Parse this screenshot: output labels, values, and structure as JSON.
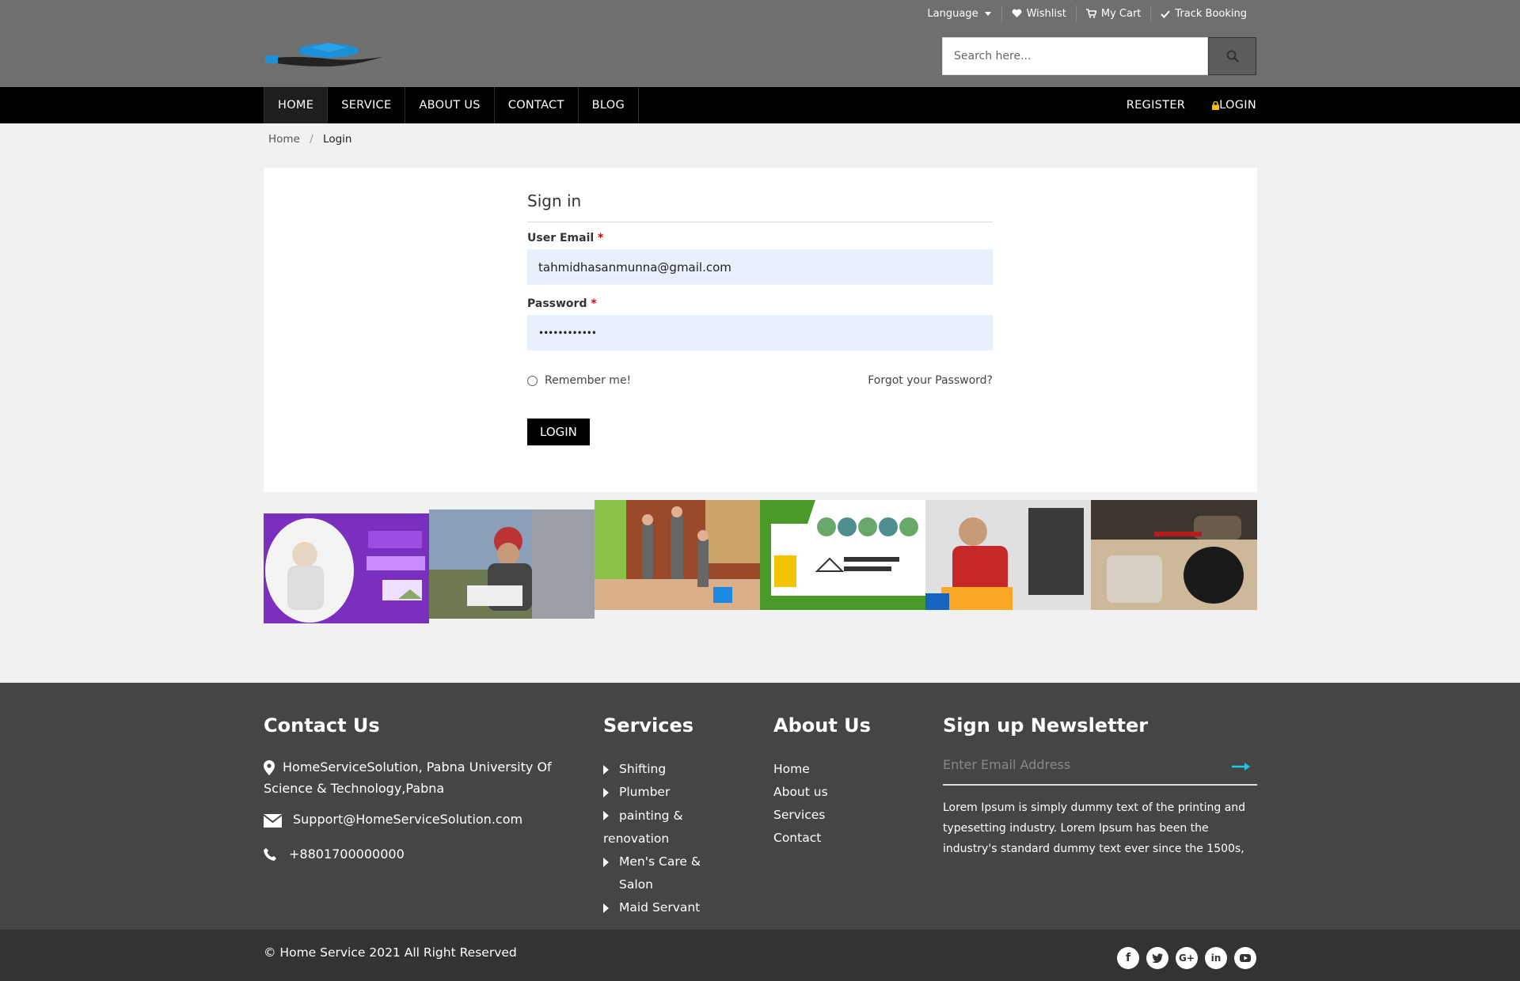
{
  "topbar": {
    "language_label": "Language",
    "wishlist_label": "Wishlist",
    "cart_label": "My Cart",
    "track_label": "Track Booking",
    "search_placeholder": "Search here..."
  },
  "nav": {
    "items": [
      {
        "label": "HOME"
      },
      {
        "label": "SERVICE"
      },
      {
        "label": "ABOUT US"
      },
      {
        "label": "CONTACT"
      },
      {
        "label": "BLOG"
      }
    ],
    "register_label": "REGISTER",
    "login_label": "LOGIN"
  },
  "breadcrumb": {
    "home": "Home",
    "separator": "/",
    "current": "Login"
  },
  "login_form": {
    "title": "Sign in",
    "email_label": "User Email",
    "required_mark": "*",
    "email_value": "tahmidhasanmunna@gmail.com",
    "password_label": "Password",
    "password_value": "••••••••••••",
    "remember_label": "Remember me!",
    "forgot_label": "Forgot your Password?",
    "submit_label": "LOGIN"
  },
  "gallery": {
    "images": [
      {
        "name": "doctor-home-visit-banner"
      },
      {
        "name": "worker-with-helmet"
      },
      {
        "name": "cleaning-team"
      },
      {
        "name": "home-service-solutions-banner"
      },
      {
        "name": "tv-repair-technician"
      },
      {
        "name": "appliance-repair"
      }
    ]
  },
  "footer": {
    "contact": {
      "heading": "Contact Us",
      "address": "HomeServiceSolution, Pabna University Of Science & Technology,Pabna",
      "email": "Support@HomeServiceSolution.com",
      "phone": "+8801700000000"
    },
    "services": {
      "heading": "Services",
      "items": [
        "Shifting",
        "Plumber",
        "painting & renovation",
        "Men's Care & Salon",
        "Maid Servant"
      ]
    },
    "about": {
      "heading": "About Us",
      "items": [
        "Home",
        "About us",
        "Services",
        "Contact"
      ]
    },
    "newsletter": {
      "heading": "Sign up Newsletter",
      "placeholder": "Enter Email Address",
      "text": "Lorem Ipsum is simply dummy text of the printing and typesetting industry. Lorem Ipsum has been the industry's standard dummy text ever since the 1500s,"
    },
    "copyright": "© Home Service 2021 All Right Reserved",
    "social": [
      "facebook-icon",
      "twitter-icon",
      "google-plus-icon",
      "linkedin-icon",
      "youtube-icon"
    ]
  }
}
